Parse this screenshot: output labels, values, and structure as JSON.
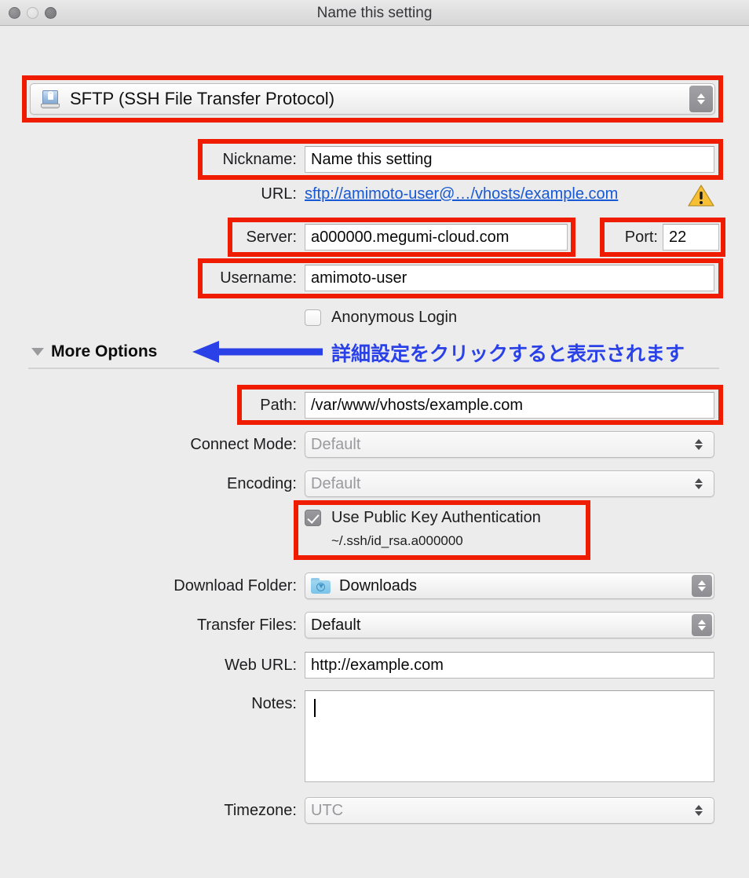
{
  "window": {
    "title": "Name this setting",
    "traffic_lights": [
      "close-button",
      "minimize-button",
      "zoom-button"
    ]
  },
  "protocol": {
    "icon": "sftp-disk-icon",
    "value": "SFTP (SSH File Transfer Protocol)"
  },
  "fields": {
    "nickname": {
      "label": "Nickname:",
      "value": "Name this setting"
    },
    "url": {
      "label": "URL:",
      "value": "sftp://amimoto-user@…/vhosts/example.com",
      "warning_icon": "warning-triangle-icon"
    },
    "server": {
      "label": "Server:",
      "value": "a000000.megumi-cloud.com"
    },
    "port": {
      "label": "Port:",
      "value": "22"
    },
    "username": {
      "label": "Username:",
      "value": "amimoto-user"
    },
    "anonymous": {
      "label": "Anonymous Login",
      "checked": false
    },
    "path": {
      "label": "Path:",
      "value": "/var/www/vhosts/example.com"
    },
    "connect_mode": {
      "label": "Connect Mode:",
      "value": "Default",
      "disabled": true
    },
    "encoding": {
      "label": "Encoding:",
      "value": "Default",
      "disabled": true
    },
    "public_key": {
      "label": "Use Public Key Authentication",
      "key_path": "~/.ssh/id_rsa.a000000",
      "checked": true
    },
    "download_folder": {
      "label": "Download Folder:",
      "value": "Downloads",
      "icon": "download-folder-icon"
    },
    "transfer_files": {
      "label": "Transfer Files:",
      "value": "Default"
    },
    "web_url": {
      "label": "Web URL:",
      "value": "http://example.com"
    },
    "notes": {
      "label": "Notes:",
      "value": ""
    },
    "timezone": {
      "label": "Timezone:",
      "value": "UTC",
      "disabled": true
    }
  },
  "more_options": {
    "label": "More Options",
    "expanded": true,
    "disclosure_icon": "triangle-down-icon"
  },
  "annotations": {
    "japanese_note": "詳細設定をクリックすると表示されます",
    "arrow_color": "#2a41e8",
    "highlight_color": "#f01c00"
  }
}
